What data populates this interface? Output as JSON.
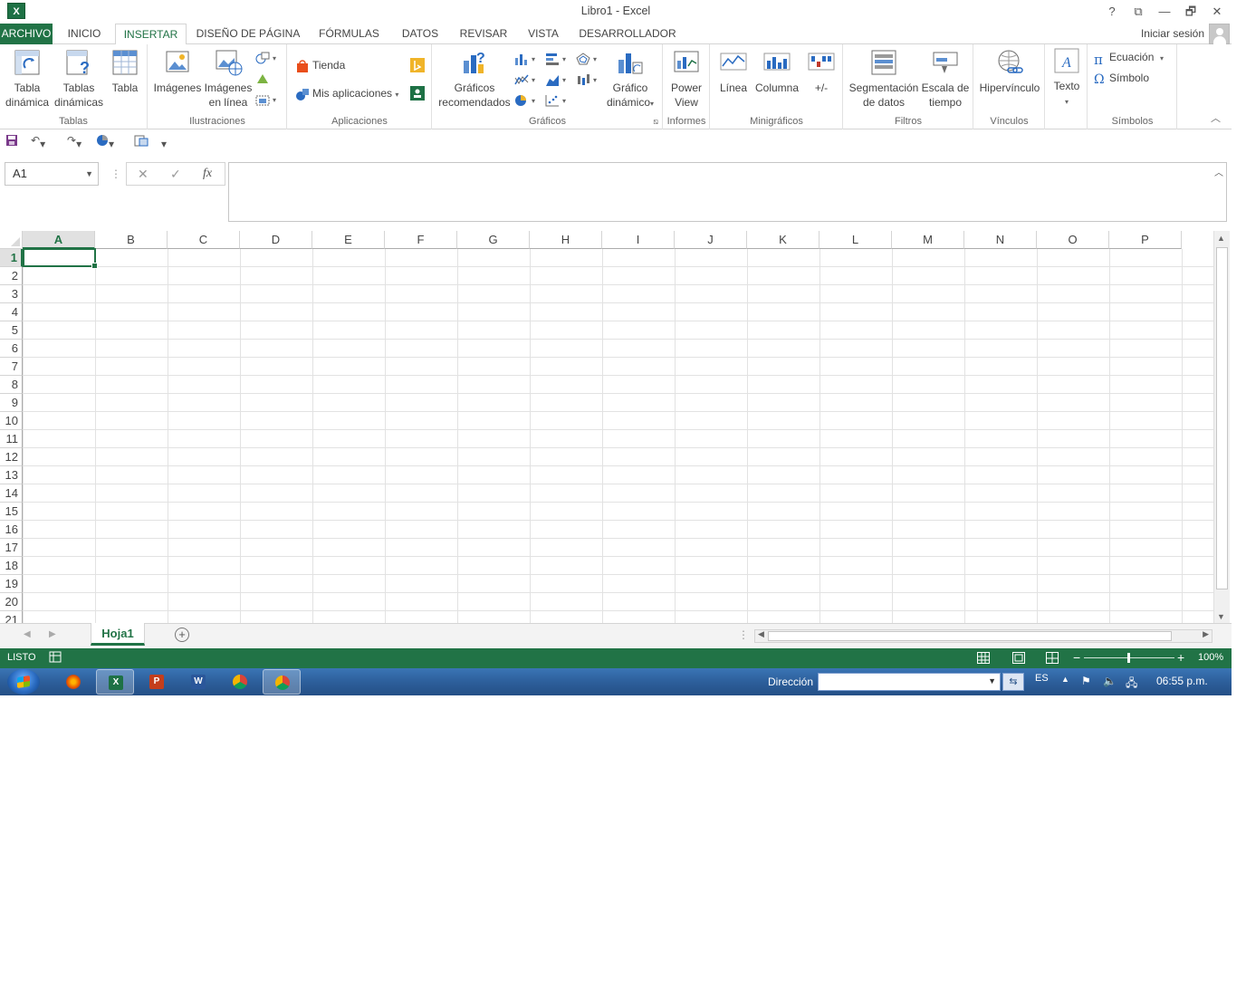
{
  "window": {
    "title": "Libro1 - Excel",
    "app_icon": "X",
    "controls": [
      "?",
      "⧉",
      "—",
      "🗗",
      "✕"
    ]
  },
  "tabs": {
    "archivo": "ARCHIVO",
    "items": [
      "INICIO",
      "INSERTAR",
      "DISEÑO DE PÁGINA",
      "FÓRMULAS",
      "DATOS",
      "REVISAR",
      "VISTA",
      "DESARROLLADOR"
    ],
    "active": "INSERTAR",
    "signin": "Iniciar sesión"
  },
  "ribbon": {
    "tablas": {
      "label": "Tablas",
      "tabla_dinamica": [
        "Tabla",
        "dinámica"
      ],
      "tablas_dinamicas": [
        "Tablas",
        "dinámicas"
      ],
      "tabla": "Tabla"
    },
    "ilustraciones": {
      "label": "Ilustraciones",
      "imagenes": "Imágenes",
      "imagenes_linea": [
        "Imágenes",
        "en línea"
      ]
    },
    "aplicaciones": {
      "label": "Aplicaciones",
      "tienda": "Tienda",
      "mis_aplicaciones": "Mis aplicaciones"
    },
    "graficos": {
      "label": "Gráficos",
      "recomendados": [
        "Gráficos",
        "recomendados"
      ],
      "dinamico": [
        "Gráfico",
        "dinámico"
      ]
    },
    "informes": {
      "label": "Informes",
      "power_view": [
        "Power",
        "View"
      ]
    },
    "minigraficos": {
      "label": "Minigráficos",
      "linea": "Línea",
      "columna": "Columna",
      "ganancia": "+/-"
    },
    "filtros": {
      "label": "Filtros",
      "segmentacion": [
        "Segmentación",
        "de datos"
      ],
      "escala": [
        "Escala de",
        "tiempo"
      ]
    },
    "vinculos": {
      "label": "Vínculos",
      "hipervinculo": "Hipervínculo"
    },
    "texto": {
      "texto": "Texto"
    },
    "simbolos": {
      "label": "Símbolos",
      "ecuacion": "Ecuación",
      "simbolo": "Símbolo"
    }
  },
  "formula_bar": {
    "name_box": "A1",
    "cancel": "✕",
    "enter": "✓",
    "fx": "fx",
    "value": ""
  },
  "sheet": {
    "columns": [
      "A",
      "B",
      "C",
      "D",
      "E",
      "F",
      "G",
      "H",
      "I",
      "J",
      "K",
      "L",
      "M",
      "N",
      "O",
      "P"
    ],
    "rows": [
      "1",
      "2",
      "3",
      "4",
      "5",
      "6",
      "7",
      "8",
      "9",
      "10",
      "11",
      "12",
      "13",
      "14",
      "15",
      "16",
      "17",
      "18",
      "19",
      "20",
      "21"
    ],
    "active_column": "A",
    "active_row": "1",
    "tab": "Hoja1"
  },
  "status": {
    "mode": "LISTO",
    "zoom": "100%"
  },
  "taskbar": {
    "address_label": "Dirección",
    "address_value": "",
    "lang": "ES",
    "time": "06:55 p.m."
  },
  "colors": {
    "excel_green": "#217346",
    "taskbar_blue": "#2d5f9b"
  }
}
